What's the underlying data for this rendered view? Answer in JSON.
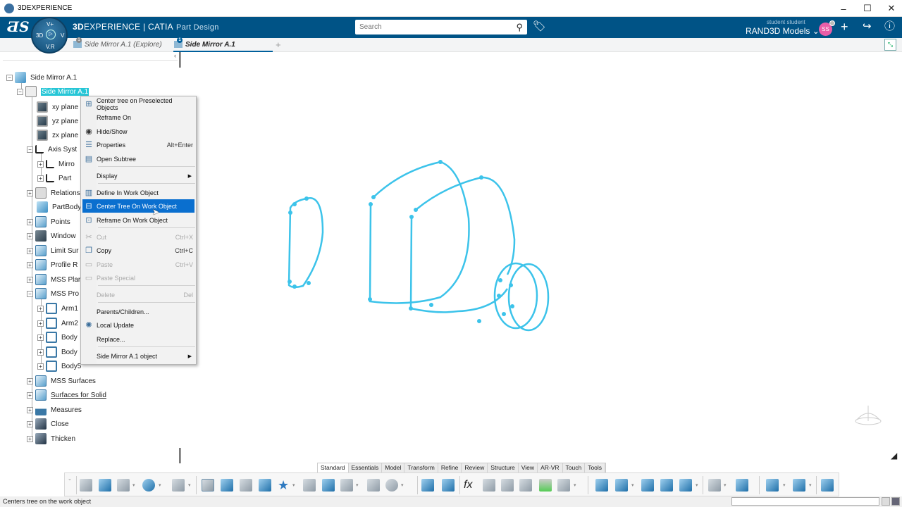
{
  "window": {
    "title": "3DEXPERIENCE",
    "controls": {
      "minimize": "–",
      "maximize": "☐",
      "close": "✕"
    }
  },
  "header": {
    "brand_bold": "3D",
    "brand_rest": "EXPERIENCE | CATIA",
    "app_name": "Part Design",
    "compass": {
      "top": "V+",
      "left": "3D",
      "right": "V",
      "bottom": "V.R"
    },
    "search_placeholder": "Search",
    "user_name": "student student",
    "collab_space": "RAND3D Models",
    "avatar_initials": "SS",
    "accent_color": "#005386"
  },
  "tabs": [
    {
      "label": "Side Mirror A.1 (Explore)",
      "badge": "1",
      "active": false
    },
    {
      "label": "Side Mirror A.1",
      "badge": "1",
      "active": true
    }
  ],
  "tree": {
    "root": "Side Mirror A.1",
    "selected": "Side Mirror A.1",
    "items": [
      {
        "label": "xy plane"
      },
      {
        "label": "yz plane"
      },
      {
        "label": "zx plane"
      },
      {
        "label": "Axis Syst"
      },
      {
        "label": "Mirro"
      },
      {
        "label": "Part"
      },
      {
        "label": "Relations"
      },
      {
        "label": "PartBody"
      },
      {
        "label": "Points"
      },
      {
        "label": "Window"
      },
      {
        "label": "Limit Sur"
      },
      {
        "label": "Profile R"
      },
      {
        "label": "MSS Plar"
      },
      {
        "label": "MSS Pro"
      },
      {
        "label": "Arm1"
      },
      {
        "label": "Arm2"
      },
      {
        "label": "Body"
      },
      {
        "label": "Body"
      },
      {
        "label": "Body5"
      },
      {
        "label": "MSS Surfaces"
      },
      {
        "label": "Surfaces for Solid"
      },
      {
        "label": "Measures"
      },
      {
        "label": "Close"
      },
      {
        "label": "Thicken"
      }
    ]
  },
  "context_menu": {
    "items": [
      {
        "label": "Center tree on Preselected Objects",
        "shortcut": ""
      },
      {
        "label": "Reframe On",
        "shortcut": ""
      },
      {
        "label": "Hide/Show",
        "shortcut": ""
      },
      {
        "label": "Properties",
        "shortcut": "Alt+Enter"
      },
      {
        "label": "Open Subtree",
        "shortcut": ""
      },
      {
        "label": "Display",
        "shortcut": ""
      },
      {
        "label": "Define In Work Object",
        "shortcut": ""
      },
      {
        "label": "Center Tree On Work Object",
        "shortcut": ""
      },
      {
        "label": "Reframe On Work Object",
        "shortcut": ""
      },
      {
        "label": "Cut",
        "shortcut": "Ctrl+X"
      },
      {
        "label": "Copy",
        "shortcut": "Ctrl+C"
      },
      {
        "label": "Paste",
        "shortcut": "Ctrl+V"
      },
      {
        "label": "Paste Special",
        "shortcut": ""
      },
      {
        "label": "Delete",
        "shortcut": "Del"
      },
      {
        "label": "Parents/Children...",
        "shortcut": ""
      },
      {
        "label": "Local Update",
        "shortcut": ""
      },
      {
        "label": "Replace...",
        "shortcut": ""
      },
      {
        "label": "Side Mirror A.1 object",
        "shortcut": ""
      }
    ],
    "highlighted": "Center Tree On Work Object",
    "highlight_color": "#0a6fcf"
  },
  "action_bar": {
    "tabs": [
      "Standard",
      "Essentials",
      "Model",
      "Transform",
      "Refine",
      "Review",
      "Structure",
      "View",
      "AR-VR",
      "Touch",
      "Tools"
    ],
    "active_tab": "Standard"
  },
  "viewport": {
    "wire_color": "#3cc3ea"
  },
  "status": {
    "text": "Centers tree on the work object"
  }
}
